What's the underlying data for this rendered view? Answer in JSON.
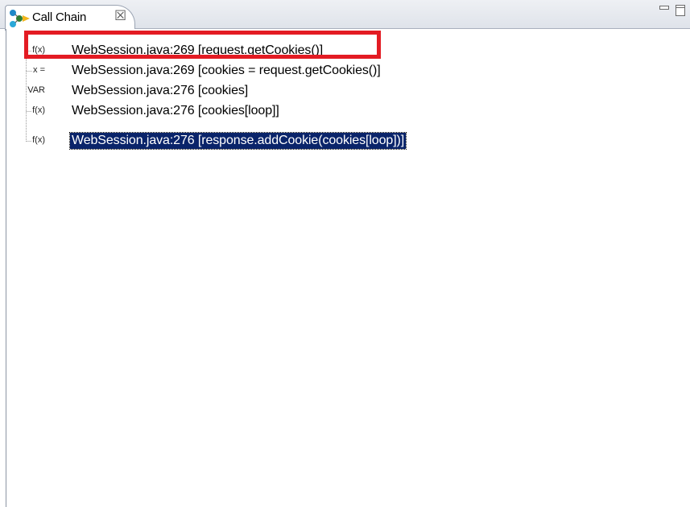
{
  "view": {
    "title": "Call Chain",
    "close_glyph": "☒",
    "icon": "call-chain-icon",
    "controls": [
      "minimize-icon",
      "maximize-icon"
    ]
  },
  "colors": {
    "selection_bg": "#0a246a",
    "selection_fg": "#ffffff",
    "highlight_border": "#e31b23"
  },
  "tree": {
    "rows": [
      {
        "kind": "f(x)",
        "label": "WebSession.java:269 [request.getCookies()]",
        "selected": false,
        "highlighted": true
      },
      {
        "kind": "x =",
        "label": "WebSession.java:269 [cookies = request.getCookies()]",
        "selected": false,
        "highlighted": false
      },
      {
        "kind": "VAR",
        "label": "WebSession.java:276 [cookies]",
        "selected": false,
        "highlighted": false
      },
      {
        "kind": "f(x)",
        "label": "WebSession.java:276 [cookies[loop]]",
        "selected": false,
        "highlighted": false
      },
      {
        "kind": "f(x)",
        "label": "WebSession.java:276 [response.addCookie(cookies[loop])]",
        "selected": true,
        "highlighted": false
      }
    ]
  }
}
